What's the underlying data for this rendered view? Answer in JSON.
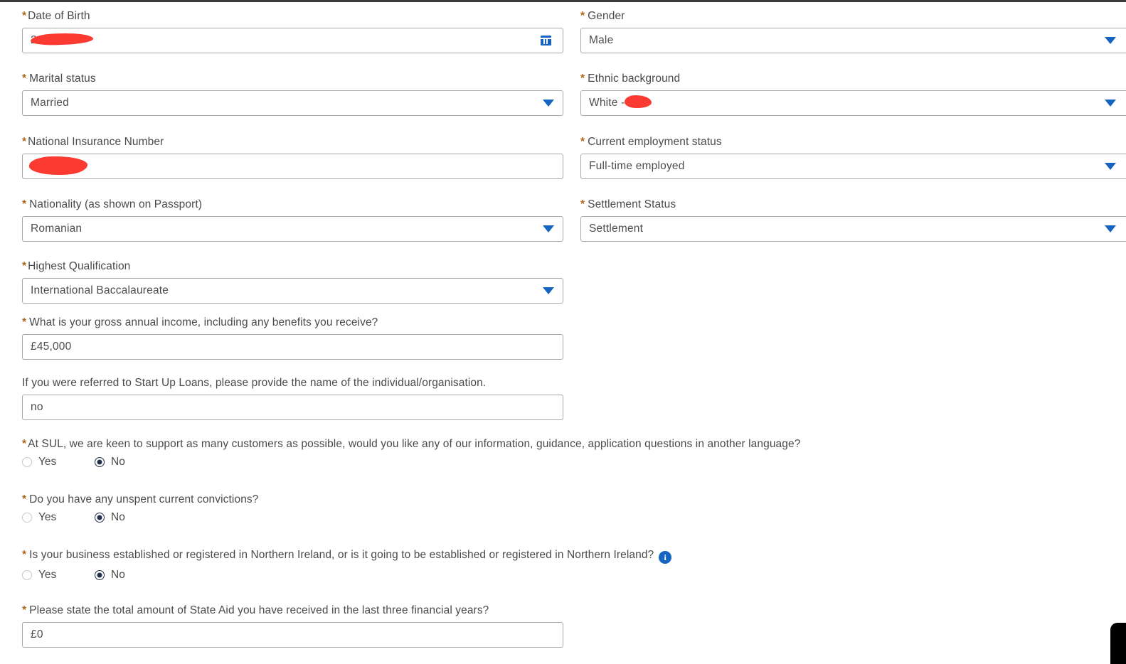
{
  "form": {
    "fields": [
      {
        "id": "date-of-birth",
        "label": "Date of Birth",
        "required": true,
        "required_spaced": false,
        "type": "date",
        "value": "2          7",
        "redacted": true,
        "icon": "calendar-icon"
      },
      {
        "id": "gender",
        "label": "Gender",
        "required": true,
        "required_spaced": true,
        "type": "select",
        "value": "Male",
        "redacted": false,
        "icon": "chevron-down-icon"
      },
      {
        "id": "marital-status",
        "label": "Marital status",
        "required": true,
        "required_spaced": true,
        "type": "select",
        "value": "Married",
        "redacted": false,
        "icon": "chevron-down-icon"
      },
      {
        "id": "ethnic-background",
        "label": "Ethnic background",
        "required": true,
        "required_spaced": true,
        "type": "select",
        "value": "White -",
        "redacted": true,
        "icon": "chevron-down-icon"
      },
      {
        "id": "national-insurance-number",
        "label": "National Insurance Number",
        "required": true,
        "required_spaced": false,
        "type": "text",
        "value": "",
        "redacted": true,
        "icon": ""
      },
      {
        "id": "current-employment-status",
        "label": "Current employment status",
        "required": true,
        "required_spaced": true,
        "type": "select",
        "value": "Full-time employed",
        "redacted": false,
        "icon": "chevron-down-icon"
      },
      {
        "id": "nationality",
        "label": "Nationality (as shown on Passport)",
        "required": true,
        "required_spaced": true,
        "type": "select",
        "value": "Romanian",
        "redacted": false,
        "icon": "chevron-down-icon"
      },
      {
        "id": "settlement-status",
        "label": "Settlement Status",
        "required": true,
        "required_spaced": true,
        "type": "select",
        "value": "Settlement",
        "redacted": false,
        "icon": "chevron-down-icon"
      },
      {
        "id": "highest-qualification",
        "label": "Highest Qualification",
        "required": true,
        "required_spaced": false,
        "type": "select",
        "value": "International Baccalaureate",
        "redacted": false,
        "icon": "chevron-down-icon"
      },
      {
        "id": "gross-annual-income",
        "label": "What is your gross annual income, including any benefits you receive?",
        "required": true,
        "required_spaced": true,
        "type": "text",
        "value": "£45,000",
        "redacted": false,
        "icon": ""
      },
      {
        "id": "referral-name",
        "label": "If you were referred to Start Up Loans, please provide the name of the individual/organisation.",
        "required": false,
        "required_spaced": false,
        "type": "text",
        "value": "no",
        "redacted": false,
        "icon": ""
      },
      {
        "id": "state-aid-total",
        "label": "Please state the total amount of State Aid you have received in the last three financial years?",
        "required": true,
        "required_spaced": true,
        "type": "text",
        "value": "£0",
        "redacted": false,
        "icon": ""
      }
    ],
    "radio_questions": [
      {
        "id": "another-language",
        "label": "At SUL, we are keen to support as many customers as possible, would you like any of our information, guidance, application questions in another language?",
        "required": true,
        "has_info_icon": false,
        "info_icon_glyph": "i",
        "options": [
          {
            "label": "Yes",
            "selected": false
          },
          {
            "label": "No",
            "selected": true
          }
        ]
      },
      {
        "id": "unspent-convictions",
        "label": "Do you have any unspent current convictions?",
        "required": true,
        "has_info_icon": false,
        "info_icon_glyph": "i",
        "options": [
          {
            "label": "Yes",
            "selected": false
          },
          {
            "label": "No",
            "selected": true
          }
        ]
      },
      {
        "id": "northern-ireland-business",
        "label": "Is your business established or registered in Northern Ireland, or is it going to be established or registered in Northern Ireland?",
        "required": true,
        "has_info_icon": true,
        "info_icon_glyph": "i",
        "options": [
          {
            "label": "Yes",
            "selected": false
          },
          {
            "label": "No",
            "selected": true
          }
        ]
      }
    ]
  },
  "colors": {
    "required_asterisk": "#b5651d",
    "label_text": "#4a4a4a",
    "value_text": "#4d4d4d",
    "field_border": "#a8a8a8",
    "accent_blue": "#1565c0",
    "radio_selected": "#21304d",
    "redaction": "#fb3b32",
    "top_border": "#3b3b3b"
  }
}
